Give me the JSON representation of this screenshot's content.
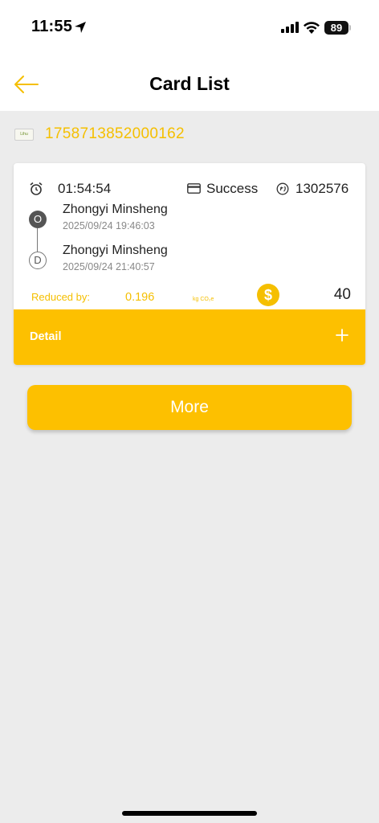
{
  "status_bar": {
    "time": "11:55",
    "battery": "89"
  },
  "header": {
    "title": "Card List"
  },
  "card": {
    "thumbnail_text": "Lihu",
    "number": "1758713852000162"
  },
  "trip": {
    "duration": "01:54:54",
    "status": "Success",
    "txn_number": "1302576",
    "origin_badge": "O",
    "origin_station": "Zhongyi Minsheng",
    "origin_time": "2025/09/24 19:46:03",
    "dest_badge": "D",
    "dest_station": "Zhongyi Minsheng",
    "dest_time": "2025/09/24 21:40:57",
    "reduced_label": "Reduced by:",
    "reduced_value": "0.196",
    "reduced_unit": "kg CO₂e",
    "dollar_symbol": "$",
    "fare": "40",
    "detail_label": "Detail"
  },
  "actions": {
    "more_label": "More"
  },
  "colors": {
    "accent": "#fdc000",
    "accent_text": "#f5bf00",
    "background": "#ececec"
  }
}
